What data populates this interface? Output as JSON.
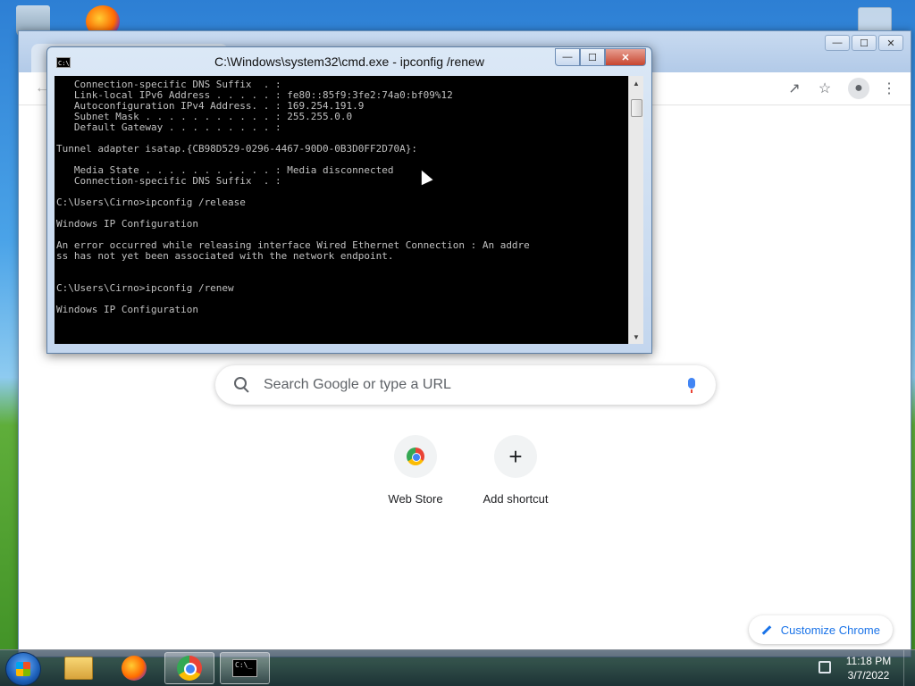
{
  "cmd": {
    "title": "C:\\Windows\\system32\\cmd.exe - ipconfig  /renew",
    "icon_text": "C:\\",
    "controls": {
      "minimize": "—",
      "maximize": "☐",
      "close": "✕"
    },
    "output": "   Connection-specific DNS Suffix  . :\n   Link-local IPv6 Address . . . . . : fe80::85f9:3fe2:74a0:bf09%12\n   Autoconfiguration IPv4 Address. . : 169.254.191.9\n   Subnet Mask . . . . . . . . . . . : 255.255.0.0\n   Default Gateway . . . . . . . . . :\n\nTunnel adapter isatap.{CB98D529-0296-4467-90D0-0B3D0FF2D70A}:\n\n   Media State . . . . . . . . . . . : Media disconnected\n   Connection-specific DNS Suffix  . :\n\nC:\\Users\\Cirno>ipconfig /release\n\nWindows IP Configuration\n\nAn error occurred while releasing interface Wired Ethernet Connection : An addre\nss has not yet been associated with the network endpoint.\n\n\nC:\\Users\\Cirno>ipconfig /renew\n\nWindows IP Configuration\n"
  },
  "chrome": {
    "search_placeholder": "Search Google or type a URL",
    "shortcuts": [
      {
        "label": "Web Store",
        "icon": "webstore-icon"
      },
      {
        "label": "Add shortcut",
        "icon": "plus-icon"
      }
    ],
    "customize_label": "Customize Chrome",
    "window_controls": {
      "minimize": "—",
      "maximize": "☐",
      "close": "✕"
    }
  },
  "taskbar": {
    "items": [
      "start",
      "windows-explorer",
      "firefox",
      "chrome",
      "cmd"
    ],
    "cmd_icon_text": "C:\\_",
    "clock_time": "11:18 PM",
    "clock_date": "3/7/2022"
  },
  "colors": {
    "console_bg": "#000000",
    "console_text": "#c0c0c0",
    "google_blue": "#1a73e8"
  }
}
